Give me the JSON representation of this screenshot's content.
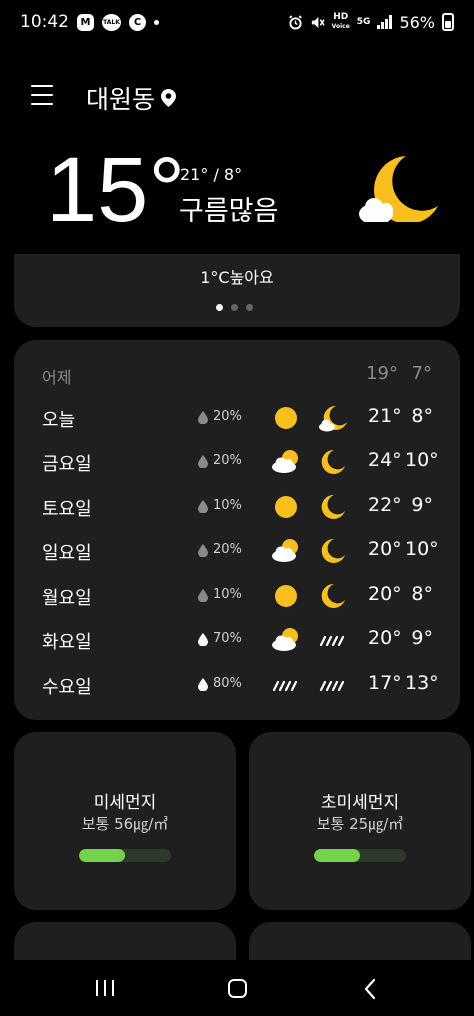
{
  "status": {
    "time": "10:42",
    "left_badges": [
      "M",
      "TALK",
      "C"
    ],
    "hd_label": "HD",
    "hd_sub": "Voice",
    "net_label": "5G",
    "battery_pct": "56%",
    "battery_level": 0.56
  },
  "header": {
    "location": "대원동"
  },
  "current": {
    "temp": "15°",
    "hilo": "21° / 8°",
    "condition": "구름많음",
    "icon": "crescent-moon-cloud-icon"
  },
  "detail": {
    "text": "1°C높아요",
    "pages": 3,
    "active_page": 0
  },
  "forecast": {
    "yesterday": {
      "label": "어제",
      "high": "19°",
      "low": "7°"
    },
    "days": [
      {
        "day": "오늘",
        "precip": "20%",
        "day_icon": "sun",
        "night_icon": "moon-cloud",
        "high": "21°",
        "low": "8°"
      },
      {
        "day": "금요일",
        "precip": "20%",
        "day_icon": "sun-cloud",
        "night_icon": "moon",
        "high": "24°",
        "low": "10°"
      },
      {
        "day": "토요일",
        "precip": "10%",
        "day_icon": "sun",
        "night_icon": "moon",
        "high": "22°",
        "low": "9°"
      },
      {
        "day": "일요일",
        "precip": "20%",
        "day_icon": "sun-cloud",
        "night_icon": "moon",
        "high": "20°",
        "low": "10°"
      },
      {
        "day": "월요일",
        "precip": "10%",
        "day_icon": "sun",
        "night_icon": "moon",
        "high": "20°",
        "low": "8°"
      },
      {
        "day": "화요일",
        "precip": "70%",
        "day_icon": "sun-cloud",
        "night_icon": "rain",
        "high": "20°",
        "low": "9°"
      },
      {
        "day": "수요일",
        "precip": "80%",
        "day_icon": "rain",
        "night_icon": "rain",
        "high": "17°",
        "low": "13°"
      }
    ]
  },
  "air": [
    {
      "title": "미세먼지",
      "value": "보통 56㎍/㎥",
      "level": 0.5
    },
    {
      "title": "초미세먼지",
      "value": "보통 25㎍/㎥",
      "level": 0.5
    }
  ],
  "colors": {
    "card": "#1f1f1f",
    "sun": "#f8bf1f",
    "bar_fill": "#76d14c",
    "bar_track": "#2d3a2a"
  }
}
